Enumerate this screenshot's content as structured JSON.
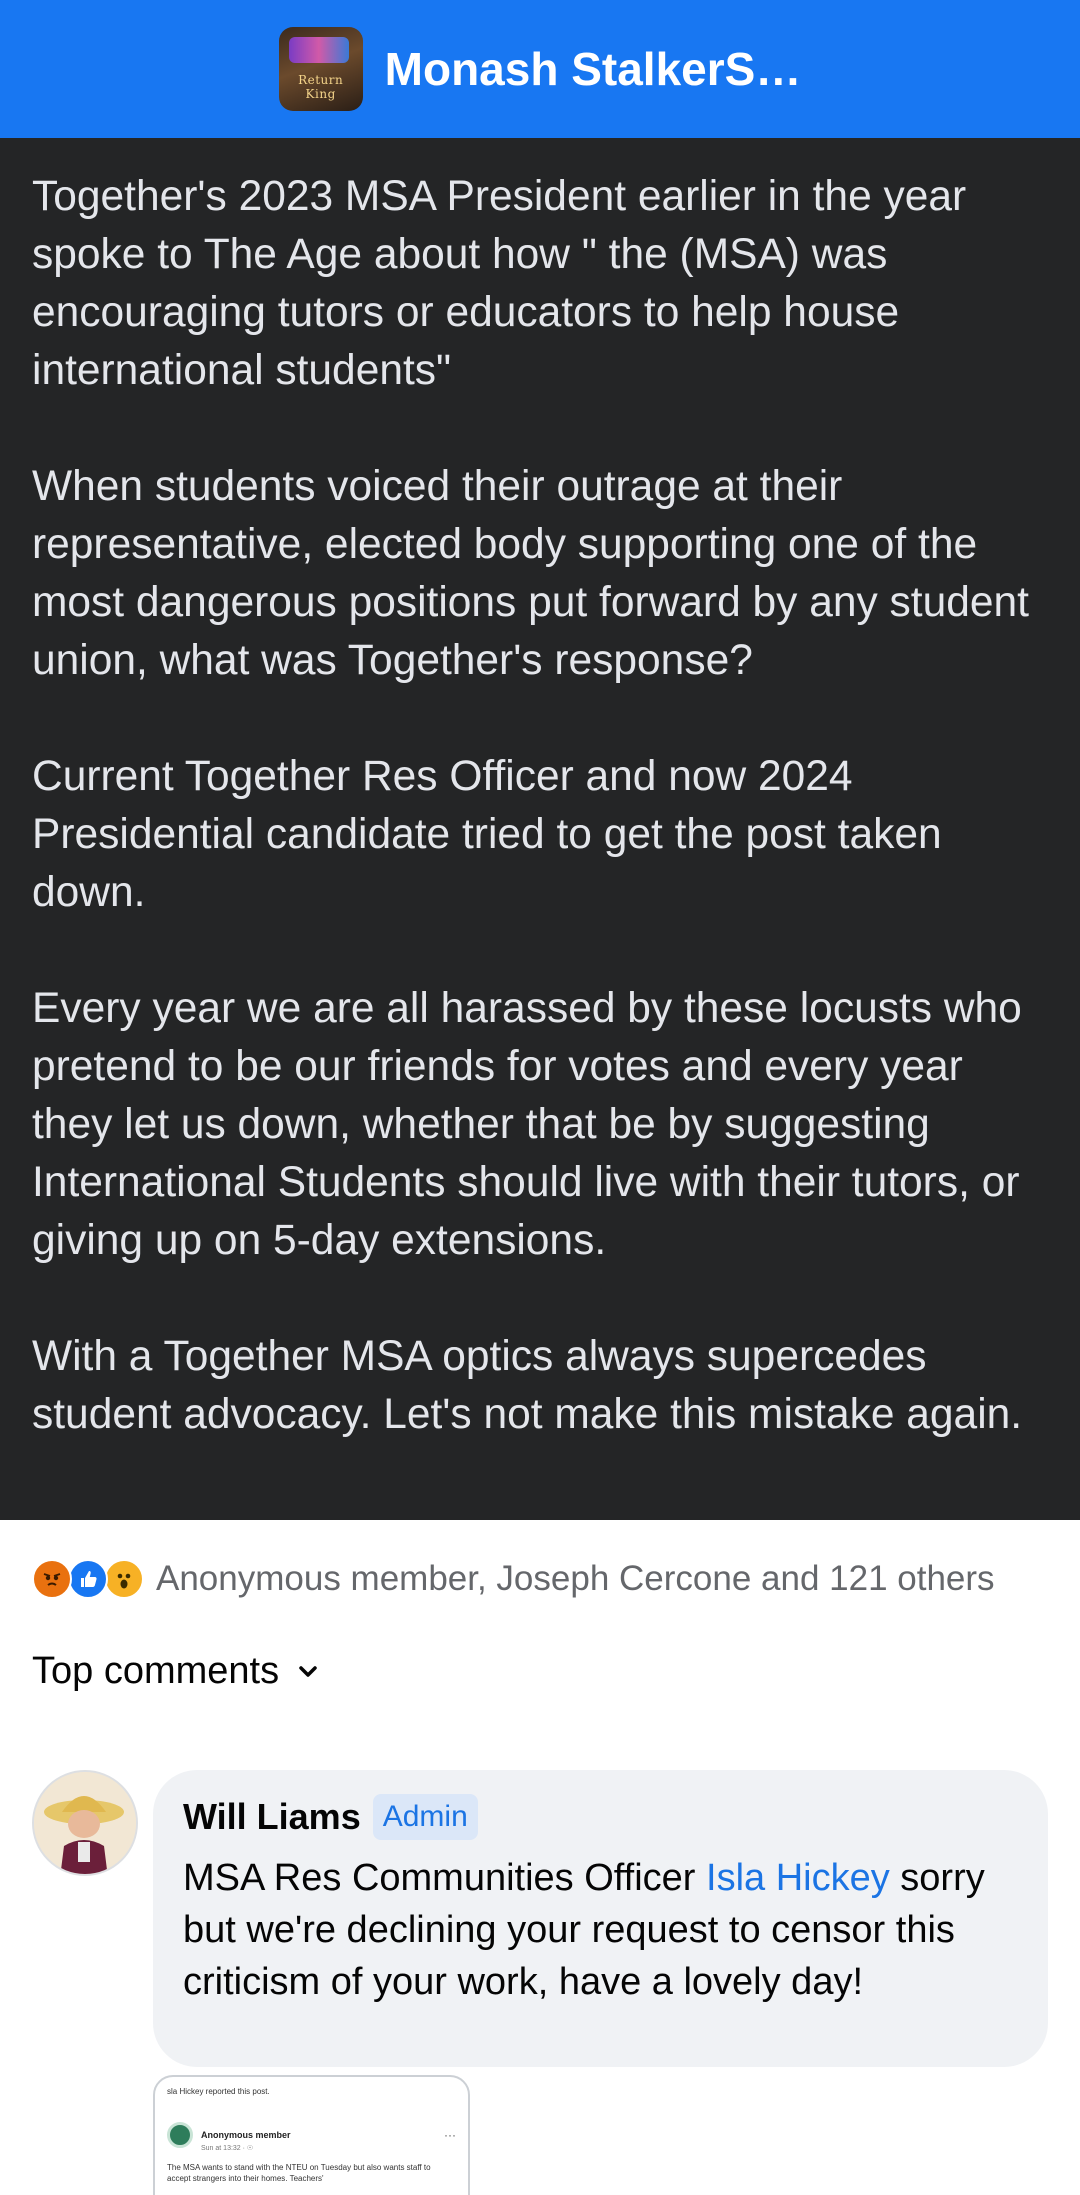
{
  "header": {
    "group_name": "Monash StalkerS…",
    "avatar_text": "Return King",
    "colors": {
      "bar": "#1877f2"
    }
  },
  "post": {
    "paragraphs": [
      "Together's 2023 MSA President earlier in the year spoke to The Age about how \" the (MSA) was encouraging tutors or educators to help house international students\"",
      "When students voiced their outrage at their representative, elected body supporting one of the most dangerous positions put forward by any student union, what was Together's response?",
      "Current Together Res Officer and now 2024 Presidential candidate tried to get the post taken down.",
      "Every year we are all harassed by these locusts who pretend to be our friends for votes and every year they let us down, whether that be by suggesting International Students should live with their tutors, or giving up on 5-day extensions.",
      "With a Together MSA optics always supercedes student advocacy. Let's not make this mistake again."
    ],
    "colors": {
      "background": "#242526",
      "text": "#e4e6eb"
    }
  },
  "reactions": {
    "icons": [
      "angry-icon",
      "like-icon",
      "wow-icon"
    ],
    "summary": "Anonymous member, Joseph Cercone and 121 others"
  },
  "comments_section": {
    "sort_label": "Top comments"
  },
  "comment": {
    "author": "Will Liams",
    "badge": "Admin",
    "text_before": "MSA Res Communities Officer ",
    "mention": "Isla Hickey",
    "text_after": " sorry but we're declining your request to censor this criticism of your work, have a lovely day!",
    "attachment": {
      "line1": "sla Hickey reported this post.",
      "name": "Anonymous member",
      "date": "Sun at 13:32 · ☉",
      "dots": "···",
      "text": "The MSA wants to stand with the NTEU on Tuesday but also wants staff to accept strangers into their homes. Teachers'"
    }
  }
}
